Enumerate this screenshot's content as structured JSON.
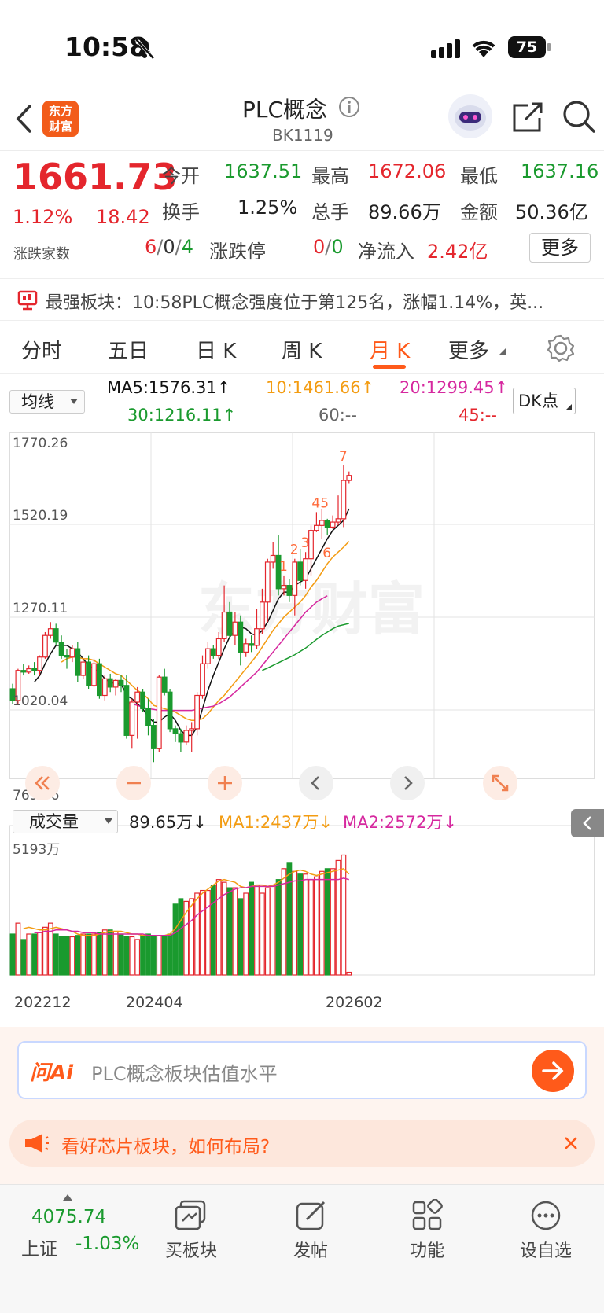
{
  "status_bar": {
    "time": "10:58",
    "battery": "75"
  },
  "header": {
    "title": "PLC概念",
    "code": "BK1119",
    "logo_text_1": "东方",
    "logo_text_2": "财富"
  },
  "quote": {
    "price": "1661.73",
    "pct": "1.12%",
    "change": "18.42",
    "open_label": "今开",
    "open": "1637.51",
    "high_label": "最高",
    "high": "1672.06",
    "low_label": "最低",
    "low": "1637.16",
    "turnover_label": "换手",
    "turnover": "1.25%",
    "volume_label": "总手",
    "volume": "89.66万",
    "amount_label": "金额",
    "amount": "50.36亿",
    "breadth_label": "涨跌家数",
    "breadth_up": "6",
    "breadth_flat": "0",
    "breadth_down": "4",
    "limit_label": "涨跌停",
    "limit_up": "0",
    "limit_down": "0",
    "netflow_label": "净流入",
    "netflow": "2.42亿",
    "more_label": "更多"
  },
  "banner": {
    "label": "最强板块：",
    "text": "10:58PLC概念强度位于第125名，涨幅1.14%，英..."
  },
  "tabs": [
    {
      "label": "分时"
    },
    {
      "label": "五日"
    },
    {
      "label": "日 K"
    },
    {
      "label": "周 K"
    },
    {
      "label": "月 K"
    },
    {
      "label": "更多"
    }
  ],
  "ma_bar": {
    "select": "均线",
    "ma5": "MA5:1576.31↑",
    "ma10": "10:1461.66↑",
    "ma20": "20:1299.45↑",
    "ma30": "30:1216.11↑",
    "ma60": "60:--",
    "ma45": "45:--",
    "dk": "DK点"
  },
  "colors": {
    "up": "#e4262d",
    "down": "#1a9a2e",
    "ma5": "#111111",
    "ma10": "#f39c12",
    "ma20": "#d6289f",
    "ma30": "#1a9a2e",
    "accent": "#ff6a1a"
  },
  "chart_data": {
    "type": "candlestick",
    "y_ticks": [
      "1770.26",
      "1520.19",
      "1270.11",
      "1020.04",
      "769.96"
    ],
    "ylim": [
      769.96,
      1770.26
    ],
    "markers": [
      "1",
      "2",
      "3",
      "45",
      "6",
      "7"
    ],
    "candles": [
      [
        1020,
        985,
        1035,
        975
      ],
      [
        985,
        1075,
        1080,
        975
      ],
      [
        1075,
        1070,
        1095,
        1060
      ],
      [
        1070,
        1080,
        1090,
        1065
      ],
      [
        1080,
        1075,
        1100,
        1060
      ],
      [
        1075,
        1115,
        1120,
        1060
      ],
      [
        1115,
        1180,
        1190,
        1110
      ],
      [
        1180,
        1200,
        1220,
        1170
      ],
      [
        1200,
        1160,
        1215,
        1150
      ],
      [
        1160,
        1120,
        1180,
        1110
      ],
      [
        1120,
        1115,
        1140,
        1080
      ],
      [
        1115,
        1140,
        1150,
        1100
      ],
      [
        1140,
        1060,
        1160,
        1040
      ],
      [
        1060,
        1100,
        1110,
        1050
      ],
      [
        1100,
        1030,
        1120,
        1020
      ],
      [
        1030,
        1095,
        1110,
        1025
      ],
      [
        1095,
        1000,
        1110,
        990
      ],
      [
        1000,
        1050,
        1060,
        985
      ],
      [
        1050,
        1025,
        1065,
        1010
      ],
      [
        1025,
        1045,
        1050,
        1000
      ],
      [
        1045,
        1030,
        1060,
        1010
      ],
      [
        1030,
        880,
        1060,
        870
      ],
      [
        880,
        980,
        990,
        840
      ],
      [
        980,
        1010,
        1025,
        870
      ],
      [
        1010,
        960,
        1020,
        950
      ],
      [
        960,
        910,
        990,
        880
      ],
      [
        910,
        840,
        930,
        800
      ],
      [
        840,
        1055,
        1060,
        830
      ],
      [
        1055,
        1010,
        1080,
        1000
      ],
      [
        1010,
        900,
        1020,
        890
      ],
      [
        900,
        885,
        910,
        860
      ],
      [
        885,
        860,
        900,
        830
      ],
      [
        860,
        895,
        910,
        850
      ],
      [
        895,
        900,
        920,
        830
      ],
      [
        900,
        1000,
        1010,
        880
      ],
      [
        1000,
        1095,
        1120,
        990
      ],
      [
        1095,
        1140,
        1160,
        1080
      ],
      [
        1140,
        1120,
        1150,
        1110
      ],
      [
        1120,
        1170,
        1190,
        1110
      ],
      [
        1170,
        1250,
        1330,
        1160
      ],
      [
        1250,
        1180,
        1280,
        1170
      ],
      [
        1180,
        1220,
        1250,
        1150
      ],
      [
        1220,
        1130,
        1240,
        1090
      ],
      [
        1130,
        1155,
        1170,
        1115
      ],
      [
        1155,
        1150,
        1180,
        1130
      ],
      [
        1150,
        1200,
        1260,
        1140
      ],
      [
        1200,
        1280,
        1320,
        1185
      ],
      [
        1280,
        1400,
        1410,
        1220
      ],
      [
        1400,
        1420,
        1460,
        1380
      ],
      [
        1420,
        1320,
        1480,
        1300
      ],
      [
        1320,
        1330,
        1360,
        1300
      ],
      [
        1330,
        1300,
        1350,
        1280
      ],
      [
        1300,
        1400,
        1410,
        1240
      ],
      [
        1400,
        1345,
        1440,
        1330
      ],
      [
        1345,
        1410,
        1430,
        1320
      ],
      [
        1410,
        1495,
        1510,
        1360
      ],
      [
        1495,
        1510,
        1550,
        1490
      ],
      [
        1510,
        1525,
        1560,
        1470
      ],
      [
        1525,
        1505,
        1530,
        1480
      ],
      [
        1505,
        1520,
        1540,
        1500
      ],
      [
        1520,
        1530,
        1600,
        1510
      ],
      [
        1530,
        1645,
        1690,
        1505
      ],
      [
        1645,
        1660,
        1672,
        1637
      ]
    ],
    "ma_lines": {
      "ma5": [
        null,
        null,
        null,
        null,
        1040,
        1060,
        1095,
        1125,
        1150,
        1150,
        1150,
        1140,
        1130,
        1110,
        1090,
        1080,
        1070,
        1050,
        1040,
        1035,
        1035,
        1000,
        990,
        975,
        960,
        935,
        920,
        920,
        935,
        945,
        925,
        895,
        880,
        880,
        905,
        960,
        1015,
        1060,
        1100,
        1140,
        1175,
        1195,
        1205,
        1200,
        1185,
        1180,
        1195,
        1220,
        1255,
        1290,
        1310,
        1310,
        1330,
        1340,
        1350,
        1380,
        1410,
        1440,
        1470,
        1495,
        1510,
        1525,
        1560
      ],
      "ma10": [
        null,
        null,
        null,
        null,
        null,
        null,
        null,
        null,
        null,
        1100,
        1110,
        1115,
        1115,
        1110,
        1110,
        1105,
        1095,
        1085,
        1075,
        1065,
        1060,
        1045,
        1030,
        1015,
        1005,
        990,
        970,
        965,
        960,
        955,
        950,
        940,
        930,
        925,
        925,
        930,
        945,
        965,
        985,
        1000,
        1020,
        1040,
        1060,
        1080,
        1100,
        1120,
        1145,
        1170,
        1195,
        1215,
        1235,
        1250,
        1265,
        1280,
        1300,
        1325,
        1345,
        1370,
        1395,
        1415,
        1430,
        1445,
        1462
      ],
      "ma20": [
        null,
        null,
        null,
        null,
        null,
        null,
        null,
        null,
        null,
        null,
        null,
        null,
        null,
        null,
        null,
        null,
        null,
        null,
        null,
        null,
        null,
        980,
        975,
        970,
        965,
        960,
        958,
        955,
        955,
        955,
        955,
        955,
        955,
        955,
        958,
        962,
        965,
        968,
        975,
        985,
        995,
        1010,
        1025,
        1040,
        1055,
        1070,
        1090,
        1110,
        1130,
        1150,
        1170,
        1190,
        1210,
        1230,
        1250,
        1265,
        1280,
        1290,
        1299
      ],
      "ma30": [
        null,
        null,
        null,
        null,
        null,
        null,
        null,
        null,
        null,
        null,
        null,
        null,
        null,
        null,
        null,
        null,
        null,
        null,
        null,
        null,
        null,
        null,
        null,
        null,
        null,
        null,
        null,
        null,
        null,
        null,
        null,
        null,
        null,
        null,
        null,
        null,
        null,
        null,
        null,
        null,
        null,
        null,
        null,
        null,
        null,
        null,
        1075,
        1082,
        1090,
        1098,
        1106,
        1114,
        1122,
        1132,
        1142,
        1155,
        1168,
        1180,
        1190,
        1200,
        1208,
        1212,
        1216
      ]
    },
    "volume_label": "5193万",
    "volumes": [
      1500,
      1900,
      1300,
      1500,
      1500,
      1550,
      1750,
      1900,
      1500,
      1400,
      1400,
      1400,
      1450,
      1500,
      1500,
      1500,
      1550,
      1650,
      1650,
      1600,
      1500,
      1400,
      1400,
      1300,
      1450,
      1500,
      1450,
      1450,
      1450,
      1500,
      2600,
      2800,
      2700,
      2800,
      3000,
      3100,
      3100,
      3300,
      3500,
      3400,
      3200,
      3200,
      2800,
      3000,
      3400,
      3300,
      3000,
      3200,
      3300,
      3500,
      3900,
      4100,
      3800,
      3700,
      3700,
      3500,
      3600,
      3800,
      3900,
      3900,
      4200,
      4400,
      100
    ],
    "ma1": [
      null,
      null,
      1700,
      1750,
      1700,
      1650,
      1650,
      1700,
      1750,
      1700,
      1650,
      1600,
      1500,
      1450,
      1450,
      1450,
      1500,
      1550,
      1600,
      1600,
      1600,
      1550,
      1500,
      1500,
      1450,
      1450,
      1450,
      1450,
      1450,
      1500,
      1700,
      2000,
      2300,
      2550,
      2800,
      3000,
      3150,
      3300,
      3450,
      3500,
      3450,
      3400,
      3250,
      3200,
      3250,
      3300,
      3300,
      3250,
      3300,
      3400,
      3550,
      3700,
      3800,
      3850,
      3800,
      3700,
      3650,
      3700,
      3750,
      3800,
      3850,
      3900,
      3700
    ],
    "ma2": [
      null,
      null,
      null,
      null,
      1550,
      1550,
      1600,
      1600,
      1650,
      1650,
      1650,
      1600,
      1600,
      1550,
      1550,
      1550,
      1500,
      1500,
      1500,
      1500,
      1500,
      1500,
      1500,
      1500,
      1500,
      1450,
      1450,
      1450,
      1450,
      1450,
      1550,
      1700,
      1850,
      2000,
      2200,
      2350,
      2500,
      2650,
      2800,
      2950,
      3050,
      3150,
      3200,
      3200,
      3250,
      3250,
      3250,
      3250,
      3250,
      3300,
      3350,
      3400,
      3450,
      3450,
      3500,
      3500,
      3500,
      3500,
      3500,
      3500,
      3500,
      3550,
      3500
    ],
    "x_ticks": [
      "202212",
      "202404",
      "202602"
    ]
  },
  "volume_bar": {
    "select": "成交量",
    "value": "89.65万↓",
    "ma1": "MA1:2437万↓",
    "ma2": "MA2:2572万↓"
  },
  "ask": {
    "placeholder": "PLC概念板块估值水平",
    "brand": "问Ai",
    "promo": "看好芯片板块，如何布局?"
  },
  "bottom_nav": {
    "index_value": "4075.74",
    "index_name": "上证",
    "index_pct": "-1.03%",
    "items": [
      {
        "label": "买板块"
      },
      {
        "label": "发帖"
      },
      {
        "label": "功能"
      },
      {
        "label": "设自选"
      }
    ]
  },
  "watermark": "东方财富"
}
